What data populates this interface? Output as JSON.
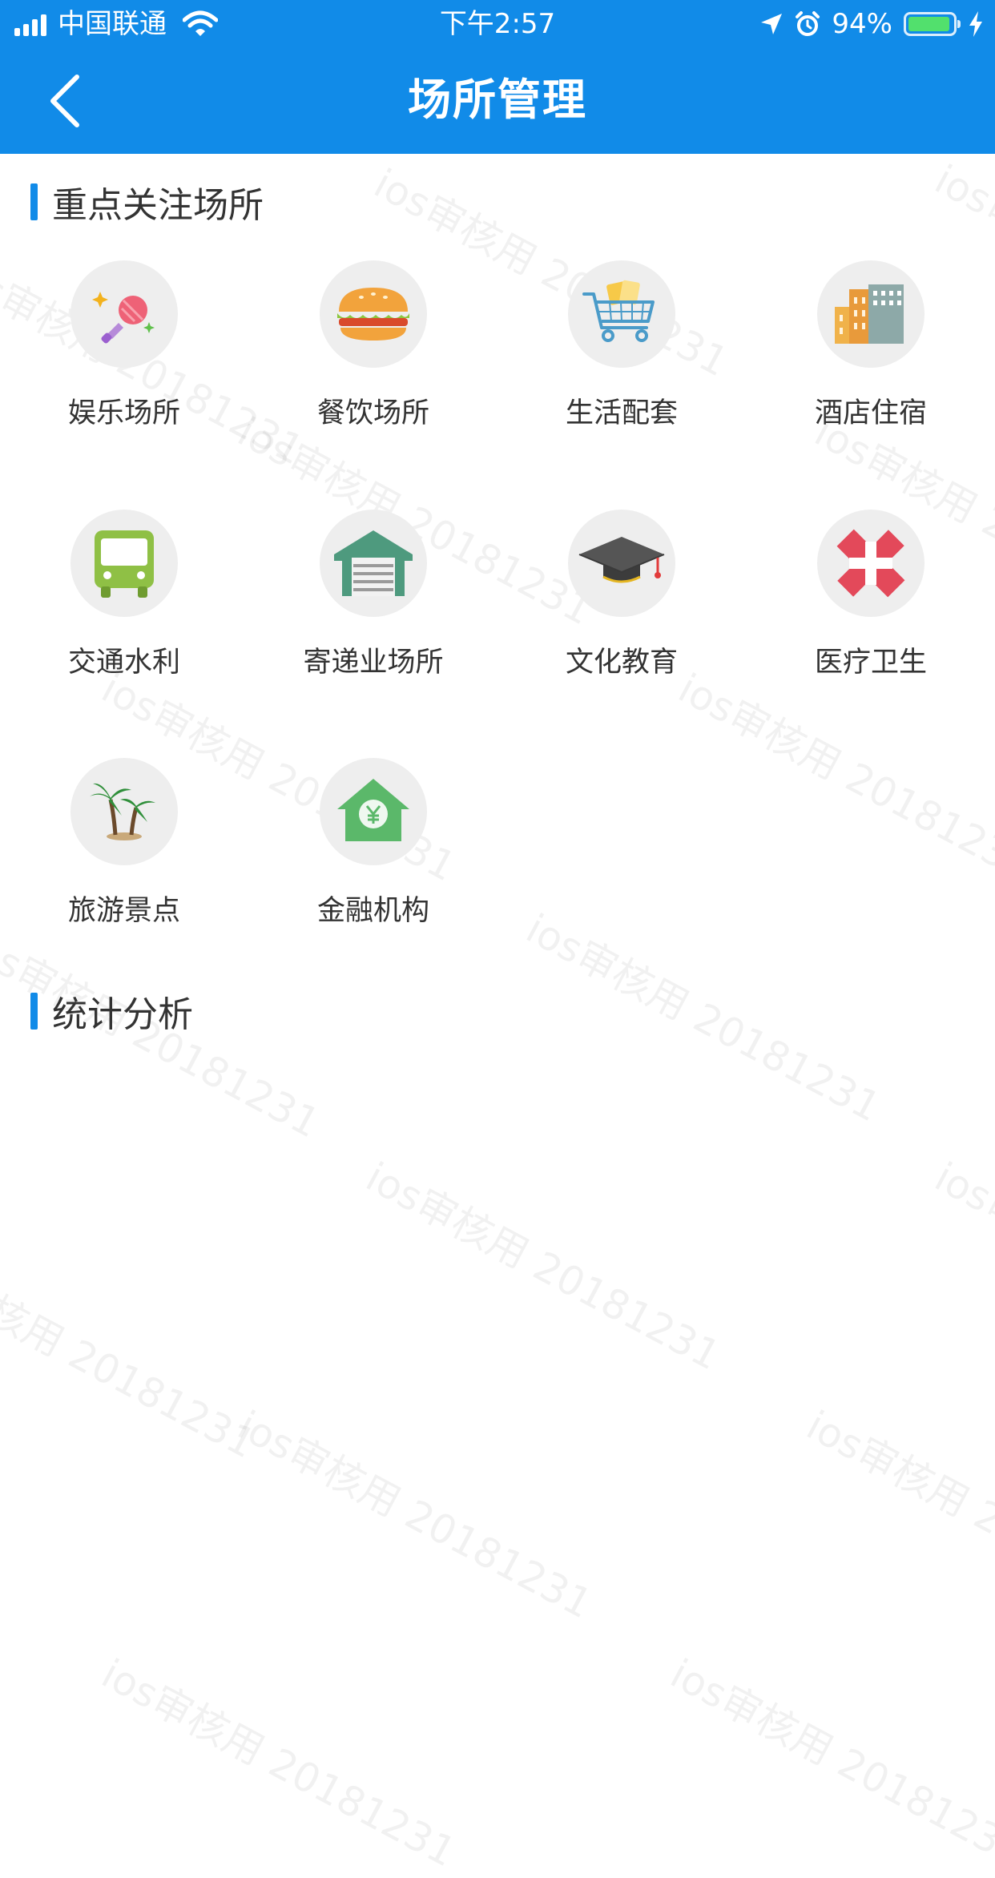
{
  "status_bar": {
    "carrier": "中国联通",
    "time": "下午2:57",
    "battery_percent": "94%",
    "battery_level": 0.94,
    "battery_color": "#52e06d"
  },
  "nav": {
    "title": "场所管理",
    "back_icon": "chevron-left-icon"
  },
  "theme": {
    "primary": "#118be8",
    "icon_background": "#eeeeee"
  },
  "sections": {
    "key_venues": {
      "title": "重点关注场所",
      "items": [
        {
          "label": "娱乐场所",
          "icon": "microphone-icon"
        },
        {
          "label": "餐饮场所",
          "icon": "burger-icon"
        },
        {
          "label": "生活配套",
          "icon": "shopping-cart-icon"
        },
        {
          "label": "酒店住宿",
          "icon": "buildings-icon"
        },
        {
          "label": "交通水利",
          "icon": "bus-icon"
        },
        {
          "label": "寄递业场所",
          "icon": "warehouse-icon"
        },
        {
          "label": "文化教育",
          "icon": "graduation-cap-icon"
        },
        {
          "label": "医疗卫生",
          "icon": "medical-cross-icon"
        },
        {
          "label": "旅游景点",
          "icon": "palm-trees-icon"
        },
        {
          "label": "金融机构",
          "icon": "bank-house-icon"
        }
      ]
    },
    "statistics": {
      "title": "统计分析"
    }
  },
  "watermark": "ios审核用 20181231"
}
